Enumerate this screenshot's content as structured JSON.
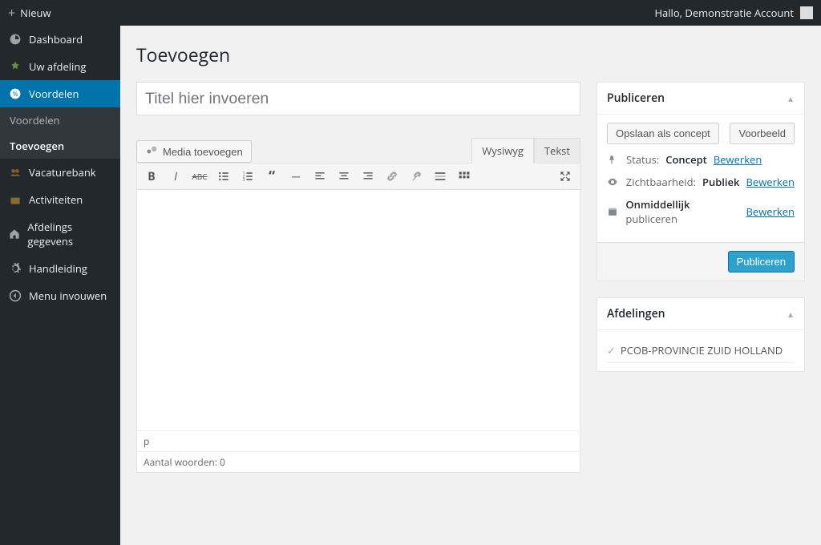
{
  "topbar": {
    "new_label": "Nieuw",
    "greeting": "Hallo, Demonstratie Account"
  },
  "sidebar": {
    "items": [
      {
        "label": "Dashboard"
      },
      {
        "label": "Uw afdeling"
      },
      {
        "label": "Voordelen"
      },
      {
        "label": "Vacaturebank"
      },
      {
        "label": "Activiteiten"
      },
      {
        "label": "Afdelings gegevens"
      },
      {
        "label": "Handleiding"
      },
      {
        "label": "Menu invouwen"
      }
    ],
    "submenu": {
      "items": [
        {
          "label": "Voordelen"
        },
        {
          "label": "Toevoegen"
        }
      ]
    }
  },
  "page": {
    "title": "Toevoegen",
    "title_placeholder": "Titel hier invoeren",
    "media_button": "Media toevoegen",
    "tab_wysiwyg": "Wysiwyg",
    "tab_text": "Tekst",
    "path": "p",
    "wordcount": "Aantal woorden: 0"
  },
  "publish": {
    "box_title": "Publiceren",
    "save_draft": "Opslaan als concept",
    "preview": "Voorbeeld",
    "status_label": "Status:",
    "status_value": "Concept",
    "edit": "Bewerken",
    "visibility_label": "Zichtbaarheid:",
    "visibility_value": "Publiek",
    "schedule_prefix": "Onmiddellijk",
    "schedule_suffix": "publiceren",
    "publish_button": "Publiceren"
  },
  "afdelingen": {
    "box_title": "Afdelingen",
    "items": [
      "PCOB-PROVINCIE ZUID HOLLAND"
    ]
  }
}
